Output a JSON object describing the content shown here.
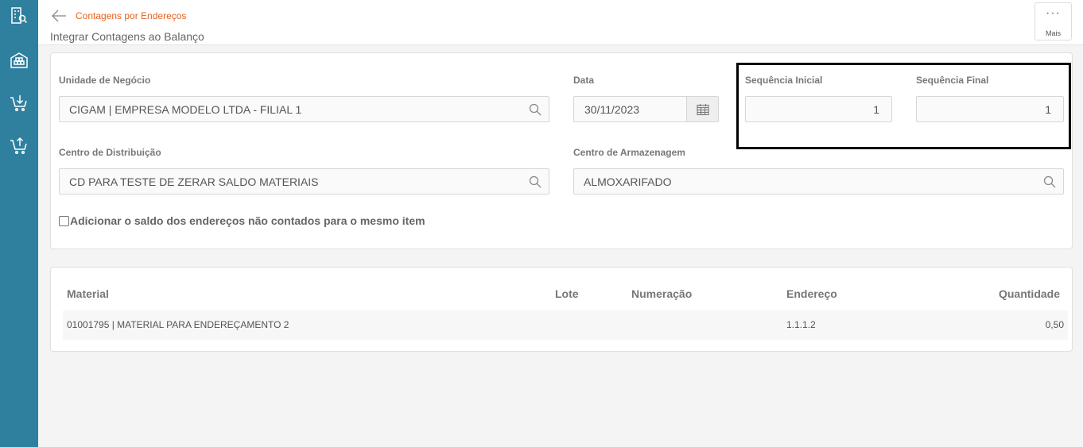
{
  "header": {
    "breadcrumb": "Contagens por Endereços",
    "title": "Integrar Contagens ao Balanço",
    "more_label": "Mais"
  },
  "sidebar": {
    "items": [
      {
        "icon": "building-search-icon"
      },
      {
        "icon": "warehouse-icon"
      },
      {
        "icon": "cart-download-icon"
      },
      {
        "icon": "cart-upload-icon"
      }
    ]
  },
  "form": {
    "unidade_label": "Unidade de Negócio",
    "unidade_value": "CIGAM | EMPRESA MODELO LTDA - FILIAL 1",
    "data_label": "Data",
    "data_value": "30/11/2023",
    "seq_inicial_label": "Sequência Inicial",
    "seq_inicial_value": "1",
    "seq_final_label": "Sequência Final",
    "seq_final_value": "1",
    "cd_label": "Centro de Distribuição",
    "cd_value": "CD PARA TESTE DE ZERAR SALDO MATERIAIS",
    "armazenagem_label": "Centro de Armazenagem",
    "armazenagem_value": "ALMOXARIFADO",
    "checkbox_label": "Adicionar o saldo dos endereços não contados para o mesmo item",
    "checkbox_checked": false
  },
  "table": {
    "headers": {
      "material": "Material",
      "lote": "Lote",
      "numeracao": "Numeração",
      "endereco": "Endereço",
      "quantidade": "Quantidade"
    },
    "rows": [
      {
        "material": "01001795 | MATERIAL PARA ENDEREÇAMENTO 2",
        "lote": "",
        "numeracao": "",
        "endereco": "1.1.1.2",
        "quantidade": "0,50"
      }
    ]
  },
  "colors": {
    "sidebar": "#2f7f9f",
    "accent": "#e8611d"
  }
}
